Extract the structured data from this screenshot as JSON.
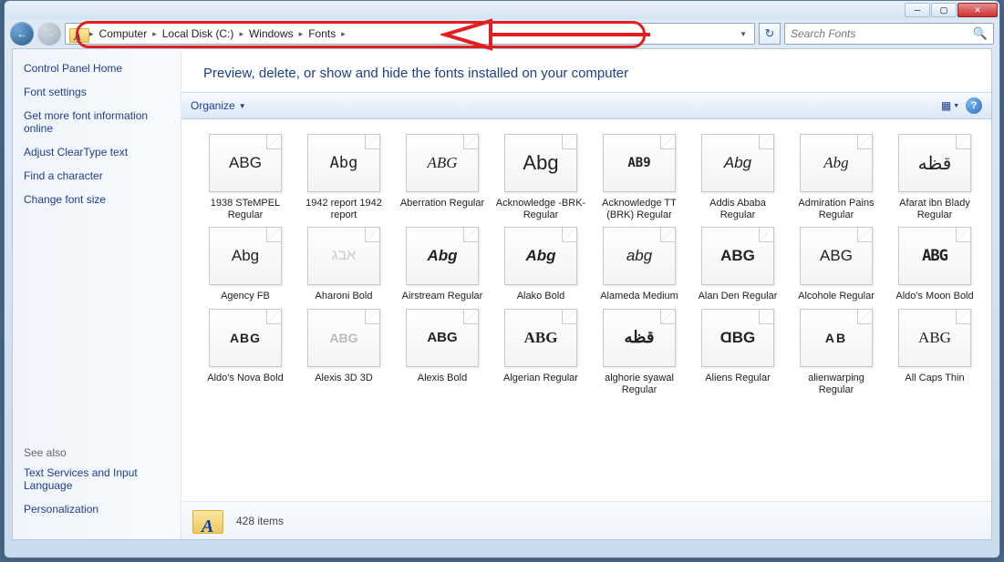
{
  "breadcrumb": {
    "items": [
      "Computer",
      "Local Disk (C:)",
      "Windows",
      "Fonts"
    ]
  },
  "search": {
    "placeholder": "Search Fonts"
  },
  "sidebar": {
    "header": "Control Panel Home",
    "links": [
      "Font settings",
      "Get more font information online",
      "Adjust ClearType text",
      "Find a character",
      "Change font size"
    ],
    "see_also_label": "See also",
    "see_also": [
      "Text Services and Input Language",
      "Personalization"
    ]
  },
  "main": {
    "title": "Preview, delete, or show and hide the fonts installed on your computer",
    "organize": "Organize"
  },
  "fonts": [
    {
      "sample": "ABG",
      "label": "1938 STeMPEL Regular",
      "stack": false,
      "style": ""
    },
    {
      "sample": "Abg",
      "label": "1942 report 1942 report",
      "stack": false,
      "style": "font-family:monospace;"
    },
    {
      "sample": "ABG",
      "label": "Aberration Regular",
      "stack": false,
      "style": "font-style:italic;font-family:serif;"
    },
    {
      "sample": "Abg",
      "label": "Acknowledge -BRK- Regular",
      "stack": false,
      "style": "font-size:22px;"
    },
    {
      "sample": "AB9",
      "label": "Acknowledge TT (BRK) Regular",
      "stack": false,
      "style": "font-weight:bold;font-family:monospace;font-size:14px;"
    },
    {
      "sample": "Abg",
      "label": "Addis Ababa Regular",
      "stack": false,
      "style": "font-style:italic;"
    },
    {
      "sample": "Abg",
      "label": "Admiration Pains Regular",
      "stack": false,
      "style": "font-family:cursive;font-style:italic;"
    },
    {
      "sample": "قظه",
      "label": "Afarat ibn Blady Regular",
      "stack": false,
      "style": "font-size:20px;"
    },
    {
      "sample": "Abg",
      "label": "Agency FB",
      "stack": true,
      "style": ""
    },
    {
      "sample": "אבג",
      "label": "Aharoni Bold",
      "stack": false,
      "style": "color:#ccc;font-size:16px;"
    },
    {
      "sample": "Abg",
      "label": "Airstream Regular",
      "stack": false,
      "style": "font-style:italic;font-weight:bold;"
    },
    {
      "sample": "Abg",
      "label": "Alako Bold",
      "stack": false,
      "style": "font-style:italic;font-weight:bold;"
    },
    {
      "sample": "abg",
      "label": "Alameda Medium",
      "stack": false,
      "style": "font-style:italic;"
    },
    {
      "sample": "ABG",
      "label": "Alan Den Regular",
      "stack": false,
      "style": "font-weight:bold;"
    },
    {
      "sample": "ABG",
      "label": "Alcohole Regular",
      "stack": false,
      "style": ""
    },
    {
      "sample": "ABG",
      "label": "Aldo's Moon Bold",
      "stack": false,
      "style": "font-weight:bold;font-family:monospace;letter-spacing:-1px;"
    },
    {
      "sample": "ABG",
      "label": "Aldo's Nova Bold",
      "stack": false,
      "style": "font-weight:bold;letter-spacing:1px;font-size:14px;"
    },
    {
      "sample": "ABG",
      "label": "Alexis 3D 3D",
      "stack": false,
      "style": "color:#bbb;font-weight:bold;font-size:14px;"
    },
    {
      "sample": "ABG",
      "label": "Alexis Bold",
      "stack": false,
      "style": "font-weight:bold;font-size:15px;"
    },
    {
      "sample": "ABG",
      "label": "Algerian Regular",
      "stack": false,
      "style": "font-family:serif;font-weight:bold;"
    },
    {
      "sample": "قظه",
      "label": "alghorie syawal Regular",
      "stack": false,
      "style": "font-size:18px;font-weight:bold;"
    },
    {
      "sample": "ⱭBG",
      "label": "Aliens Regular",
      "stack": false,
      "style": "font-weight:bold;"
    },
    {
      "sample": "AB",
      "label": "alienwarping Regular",
      "stack": false,
      "style": "font-weight:bold;letter-spacing:2px;font-size:14px;"
    },
    {
      "sample": "ABG",
      "label": "All Caps Thin",
      "stack": false,
      "style": "font-family:cursive;"
    }
  ],
  "status": {
    "count": "428 items"
  }
}
